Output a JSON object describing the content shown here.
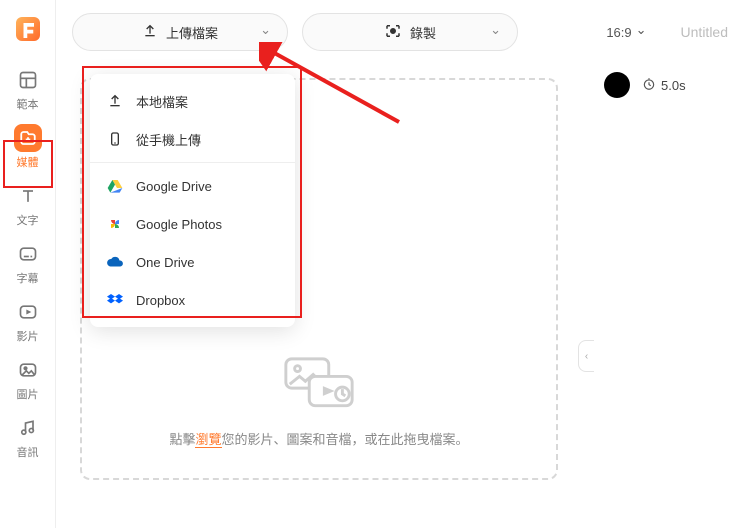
{
  "sidebar": {
    "items": [
      {
        "label": "範本"
      },
      {
        "label": "媒體"
      },
      {
        "label": "文字"
      },
      {
        "label": "字幕"
      },
      {
        "label": "影片"
      },
      {
        "label": "圖片"
      },
      {
        "label": "音訊"
      }
    ]
  },
  "toolbar": {
    "upload_label": "上傳檔案",
    "record_label": "錄製"
  },
  "header": {
    "aspect": "16:9",
    "title": "Untitled"
  },
  "dropdown": {
    "local": "本地檔案",
    "phone": "從手機上傳",
    "gdrive": "Google Drive",
    "gphotos": "Google Photos",
    "onedrive": "One Drive",
    "dropbox": "Dropbox"
  },
  "dropzone": {
    "pre": "點擊",
    "link": "瀏覽",
    "mid": "您的影片、圖案和音檔，或在此拖曳檔案。"
  },
  "timeline": {
    "duration": "5.0s"
  }
}
